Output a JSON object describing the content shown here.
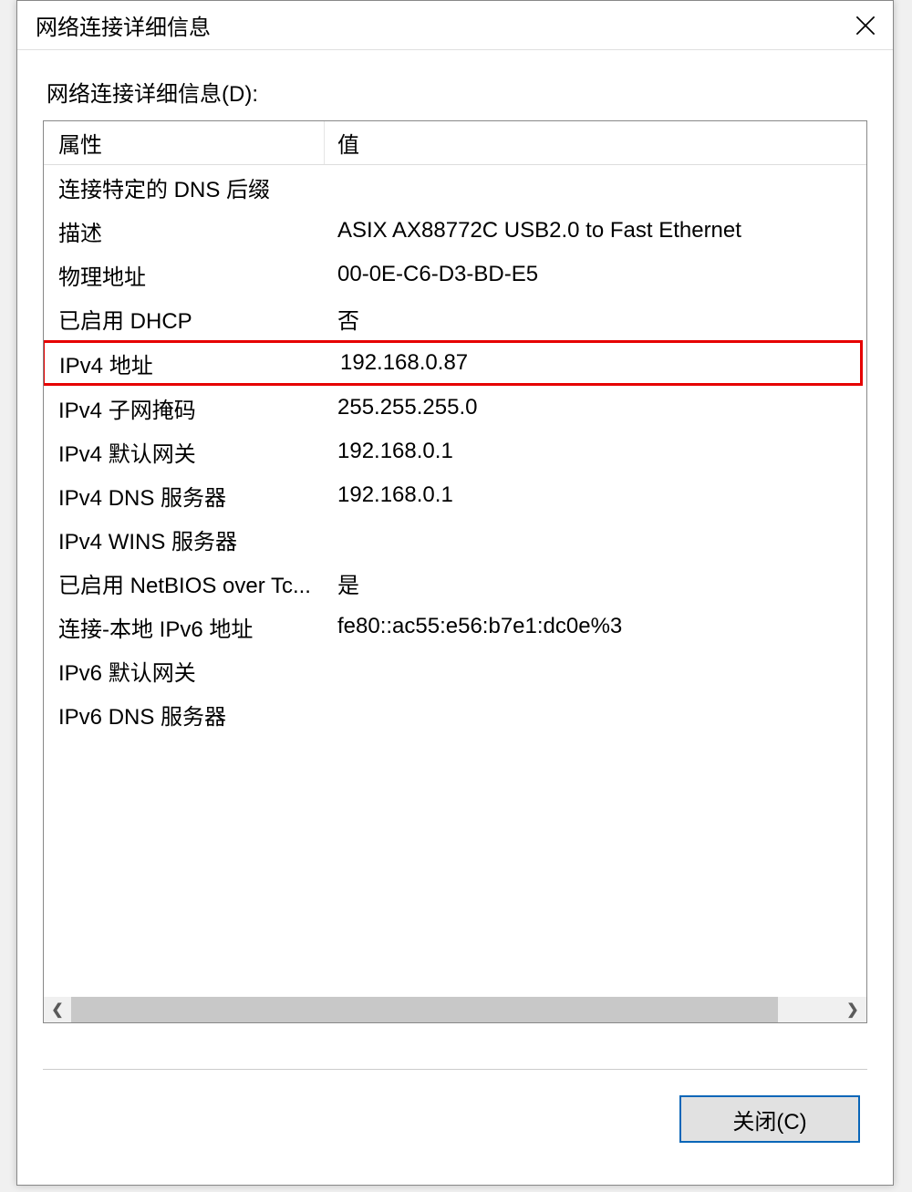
{
  "dialog": {
    "title": "网络连接详细信息",
    "subtitle": "网络连接详细信息(D):",
    "columns": {
      "property": "属性",
      "value": "值"
    },
    "rows": [
      {
        "property": "连接特定的 DNS 后缀",
        "value": ""
      },
      {
        "property": "描述",
        "value": "ASIX AX88772C USB2.0 to Fast Ethernet"
      },
      {
        "property": "物理地址",
        "value": "00-0E-C6-D3-BD-E5"
      },
      {
        "property": "已启用 DHCP",
        "value": "否"
      },
      {
        "property": "IPv4 地址",
        "value": "192.168.0.87",
        "highlight": true
      },
      {
        "property": "IPv4 子网掩码",
        "value": "255.255.255.0"
      },
      {
        "property": "IPv4 默认网关",
        "value": "192.168.0.1"
      },
      {
        "property": "IPv4 DNS 服务器",
        "value": "192.168.0.1"
      },
      {
        "property": "IPv4 WINS 服务器",
        "value": ""
      },
      {
        "property": "已启用 NetBIOS over Tc...",
        "value": "是"
      },
      {
        "property": "连接-本地 IPv6 地址",
        "value": "fe80::ac55:e56:b7e1:dc0e%3"
      },
      {
        "property": "IPv6 默认网关",
        "value": ""
      },
      {
        "property": "IPv6 DNS 服务器",
        "value": ""
      }
    ],
    "closeButton": "关闭(C)"
  }
}
